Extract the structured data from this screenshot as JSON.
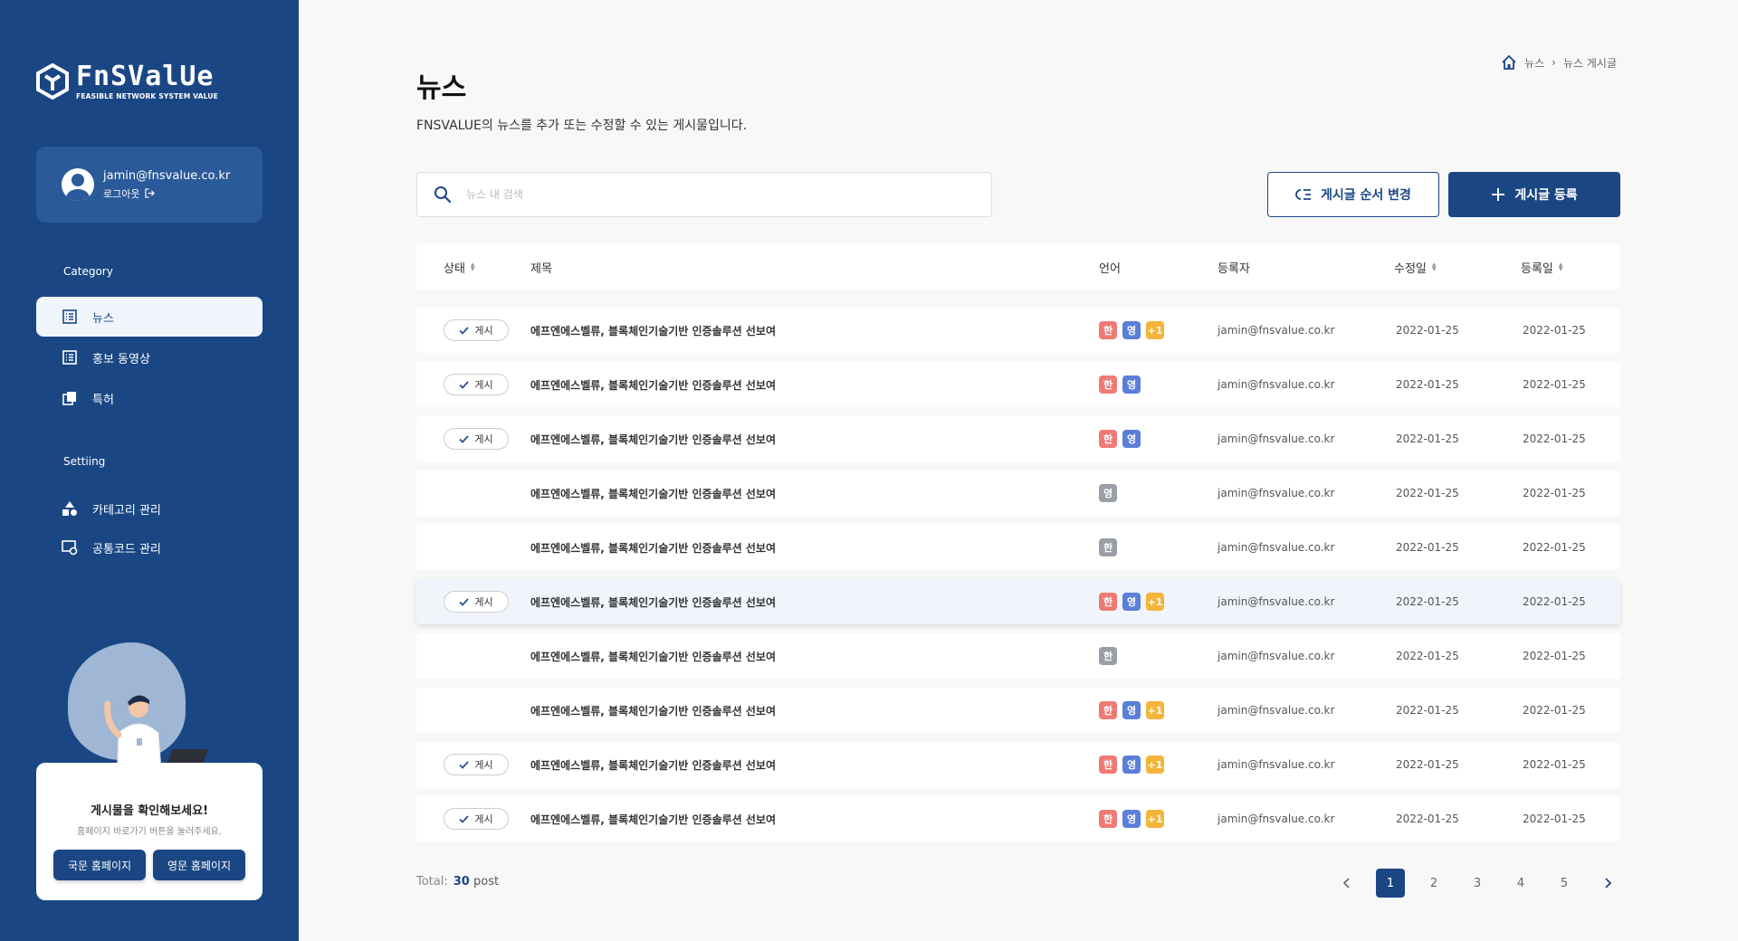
{
  "brand": {
    "name": "FnSValUe",
    "tagline": "FEASIBLE NETWORK SYSTEM VALUE"
  },
  "user": {
    "email": "jamin@fnsvalue.co.kr",
    "logout_label": "로그아웃"
  },
  "sidebar": {
    "category_label": "Category",
    "category_items": [
      {
        "label": "뉴스",
        "icon": "list-icon",
        "active": true
      },
      {
        "label": "홍보 동영상",
        "icon": "list-icon",
        "active": false
      },
      {
        "label": "특허",
        "icon": "copy-icon",
        "active": false
      }
    ],
    "setting_label": "Settiing",
    "setting_items": [
      {
        "label": "카테고리 관리",
        "icon": "shapes-icon"
      },
      {
        "label": "공통코드 관리",
        "icon": "screen-gear-icon"
      }
    ],
    "promo": {
      "title": "게시물을 확인해보세요!",
      "subtitle": "홈페이지 바로가기 버튼을 눌러주세요.",
      "korean_btn": "국문 홈페이지",
      "english_btn": "영문 홈페이지"
    }
  },
  "breadcrumb": {
    "home_icon": "home-icon",
    "items": [
      "뉴스",
      "뉴스 게시글"
    ]
  },
  "page": {
    "title": "뉴스",
    "description": "FNSVALUE의 뉴스를 추가 또는 수정할 수 있는 게시물입니다."
  },
  "search": {
    "placeholder": "뉴스 내 검색",
    "value": ""
  },
  "toolbar": {
    "order_label": "게시글 순서 변경",
    "add_label": "게시글 등록"
  },
  "table": {
    "headers": {
      "status": "상태",
      "title": "제목",
      "language": "언어",
      "author": "등록자",
      "modified": "수정일",
      "created": "등록일"
    },
    "rows": [
      {
        "status": "게시",
        "title": "에프엔에스벨류, 블록체인기술기반 인증솔루션 선보여",
        "langs": [
          "한",
          "영",
          "+1"
        ],
        "author": "jamin@fnsvalue.co.kr",
        "modified": "2022-01-25",
        "created": "2022-01-25",
        "highlight": false
      },
      {
        "status": "게시",
        "title": "에프엔에스벨류, 블록체인기술기반 인증솔루션 선보여",
        "langs": [
          "한",
          "영"
        ],
        "author": "jamin@fnsvalue.co.kr",
        "modified": "2022-01-25",
        "created": "2022-01-25",
        "highlight": false
      },
      {
        "status": "게시",
        "title": "에프엔에스벨류, 블록체인기술기반 인증솔루션 선보여",
        "langs": [
          "한",
          "영"
        ],
        "author": "jamin@fnsvalue.co.kr",
        "modified": "2022-01-25",
        "created": "2022-01-25",
        "highlight": false
      },
      {
        "status": "",
        "title": "에프엔에스벨류, 블록체인기술기반 인증솔루션 선보여",
        "langs": [
          "영-gray"
        ],
        "author": "jamin@fnsvalue.co.kr",
        "modified": "2022-01-25",
        "created": "2022-01-25",
        "highlight": false
      },
      {
        "status": "",
        "title": "에프엔에스벨류, 블록체인기술기반 인증솔루션 선보여",
        "langs": [
          "한-gray"
        ],
        "author": "jamin@fnsvalue.co.kr",
        "modified": "2022-01-25",
        "created": "2022-01-25",
        "highlight": false
      },
      {
        "status": "게시",
        "title": "에프엔에스벨류, 블록체인기술기반 인증솔루션 선보여",
        "langs": [
          "한",
          "영",
          "+1"
        ],
        "author": "jamin@fnsvalue.co.kr",
        "modified": "2022-01-25",
        "created": "2022-01-25",
        "highlight": true
      },
      {
        "status": "",
        "title": "에프엔에스벨류, 블록체인기술기반 인증솔루션 선보여",
        "langs": [
          "한-gray"
        ],
        "author": "jamin@fnsvalue.co.kr",
        "modified": "2022-01-25",
        "created": "2022-01-25",
        "highlight": false
      },
      {
        "status": "",
        "title": "에프엔에스벨류, 블록체인기술기반 인증솔루션 선보여",
        "langs": [
          "한",
          "영",
          "+1"
        ],
        "author": "jamin@fnsvalue.co.kr",
        "modified": "2022-01-25",
        "created": "2022-01-25",
        "highlight": false
      },
      {
        "status": "게시",
        "title": "에프엔에스벨류, 블록체인기술기반 인증솔루션 선보여",
        "langs": [
          "한",
          "영",
          "+1"
        ],
        "author": "jamin@fnsvalue.co.kr",
        "modified": "2022-01-25",
        "created": "2022-01-25",
        "highlight": false
      },
      {
        "status": "게시",
        "title": "에프엔에스벨류, 블록체인기술기반 인증솔루션 선보여",
        "langs": [
          "한",
          "영",
          "+1"
        ],
        "author": "jamin@fnsvalue.co.kr",
        "modified": "2022-01-25",
        "created": "2022-01-25",
        "highlight": false
      }
    ]
  },
  "footer": {
    "total_label": "Total:",
    "total_count": "30",
    "total_unit": "post",
    "pages": [
      "1",
      "2",
      "3",
      "4",
      "5"
    ],
    "current_page": "1"
  },
  "colors": {
    "primary": "#1a4784",
    "lang_ko": "#ef7a74",
    "lang_en": "#5b7fd9",
    "lang_more": "#f5b43a",
    "lang_inactive": "#9a9ea6"
  }
}
